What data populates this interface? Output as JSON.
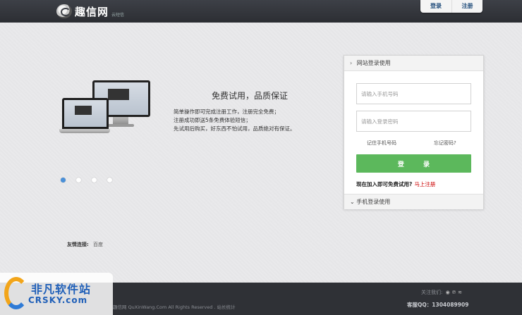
{
  "header": {
    "logo_text": "趣信网",
    "logo_sub": "云短信",
    "login_tab": "登录",
    "register_tab": "注册"
  },
  "promo": {
    "title": "免费试用，品质保证",
    "lines": [
      "简单操作即可完成注册工作，注册完全免费；",
      "注册成功即送5条免费体验短信；",
      "先试用后购买，好东西不怕试用，品质绝对有保证。"
    ],
    "slides_count": 4,
    "active_slide": 1
  },
  "friends": {
    "label": "友情连接:",
    "link": "百度"
  },
  "login_panel": {
    "web_login_header": "网站登录使用",
    "phone_placeholder": "请输入手机号码",
    "password_placeholder": "请输入登录密码",
    "remember": "记住手机号码",
    "forgot": "忘记密码?",
    "login_button": "登 录",
    "trial_text": "现在加入即可免费试用?",
    "register_link": "马上注册",
    "mobile_login_header": "手机登录使用"
  },
  "footer": {
    "copyright": "趣信网 QuXinWang.Com All Rights Reserved . 站长统计",
    "follow_label": "关注我们:",
    "qq": "客服QQ：1304089909"
  },
  "watermark": {
    "cn": "非凡软件站",
    "en": "CRSKY.com"
  },
  "colors": {
    "accent_green": "#5cb85c",
    "link_red": "#cc0000",
    "topbar": "#3d4047"
  }
}
